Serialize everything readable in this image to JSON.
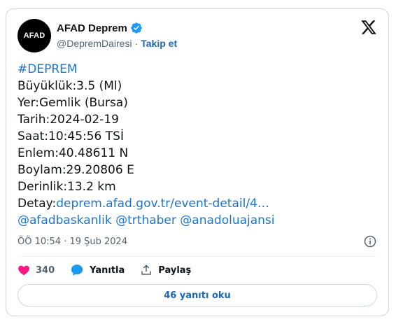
{
  "account": {
    "avatar_text": "AFAD",
    "display_name": "AFAD Deprem",
    "handle": "@DepremDairesi",
    "separator": "·",
    "follow_label": "Takip et"
  },
  "tweet": {
    "hashtag": "#DEPREM",
    "lines": [
      "Büyüklük:3.5 (Ml)",
      "Yer:Gemlik (Bursa)",
      "Tarih:2024-02-19",
      "Saat:10:45:56 TSİ",
      "Enlem:40.48611 N",
      "Boylam:29.20806 E",
      "Derinlik:13.2 km"
    ],
    "detail_prefix": "Detay:",
    "detail_link": "deprem.afad.gov.tr/event-detail/4…",
    "mentions": [
      "@afadbaskanlik",
      "@trthaber",
      "@anadoluajansi"
    ]
  },
  "meta": {
    "timestamp": "ÖÖ 10:54 · 19 Şub 2024"
  },
  "actions": {
    "likes": "340",
    "reply_label": "Yanıtla",
    "share_label": "Paylaş"
  },
  "read_replies_label": "46 yanıtı oku",
  "colors": {
    "link": "#1d74c9",
    "verified": "#1d9bf0",
    "like": "#f91880",
    "reply_icon": "#1d9bf0"
  }
}
